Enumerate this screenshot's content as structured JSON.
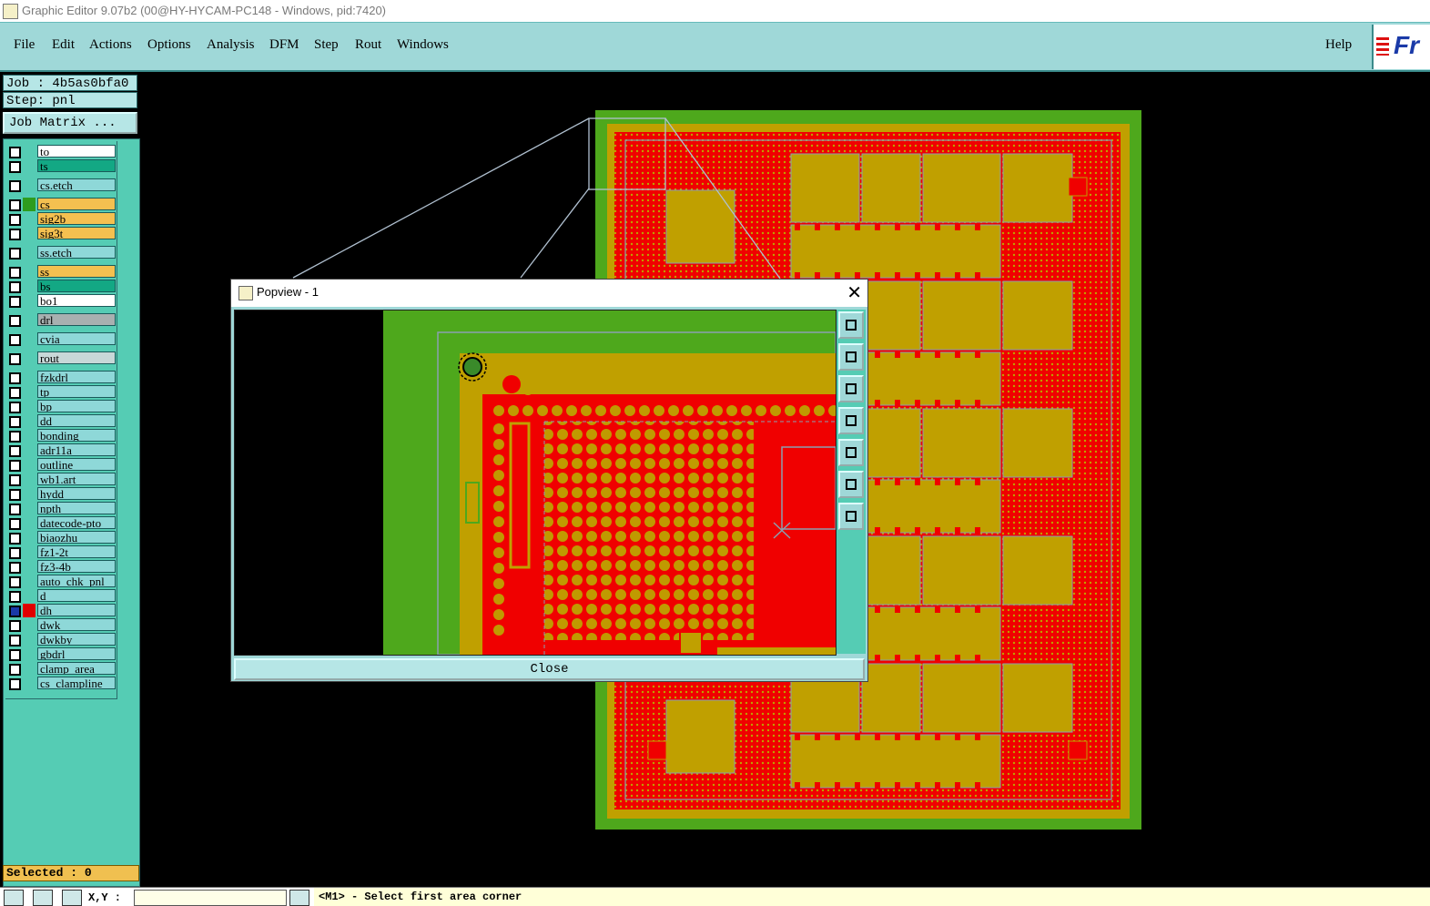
{
  "window": {
    "title": "Graphic Editor 9.07b2 (00@HY-HYCAM-PC148 - Windows, pid:7420)"
  },
  "menubar": {
    "items": [
      "File",
      "Edit",
      "Actions",
      "Options",
      "Analysis",
      "DFM",
      "Step",
      "Rout",
      "Windows"
    ],
    "help": "Help",
    "logo_text": "Fr"
  },
  "job": {
    "label": "Job : 4b5as0bfa0",
    "step": "Step: pnl",
    "matrix_button": "Job Matrix ..."
  },
  "layers": [
    {
      "name": "to",
      "color": "#ffffff",
      "swatch": ""
    },
    {
      "name": "ts",
      "color": "#13a884",
      "swatch": ""
    },
    {
      "name": "cs.etch",
      "color": "#8ed8d8",
      "swatch": ""
    },
    {
      "name": "cs",
      "color": "#f4c050",
      "swatch": "#2e9c1e"
    },
    {
      "name": "sig2b",
      "color": "#f4c050",
      "swatch": ""
    },
    {
      "name": "sig3t",
      "color": "#f4c050",
      "swatch": ""
    },
    {
      "name": "ss.etch",
      "color": "#8ed8d8",
      "swatch": ""
    },
    {
      "name": "ss",
      "color": "#f4c050",
      "swatch": ""
    },
    {
      "name": "bs",
      "color": "#13a884",
      "swatch": ""
    },
    {
      "name": "bo1",
      "color": "#ffffff",
      "swatch": ""
    },
    {
      "name": "drl",
      "color": "#a8b0b0",
      "swatch": ""
    },
    {
      "name": "cvia",
      "color": "#8ed8d8",
      "swatch": ""
    },
    {
      "name": "rout",
      "color": "#c8d8d8",
      "swatch": ""
    },
    {
      "name": "fzkdrl",
      "color": "#8ed8d8",
      "swatch": ""
    },
    {
      "name": "tp",
      "color": "#8ed8d8",
      "swatch": ""
    },
    {
      "name": "bp",
      "color": "#8ed8d8",
      "swatch": ""
    },
    {
      "name": "dd",
      "color": "#8ed8d8",
      "swatch": ""
    },
    {
      "name": "bonding",
      "color": "#8ed8d8",
      "swatch": ""
    },
    {
      "name": "adr11a",
      "color": "#8ed8d8",
      "swatch": ""
    },
    {
      "name": "outline",
      "color": "#8ed8d8",
      "swatch": ""
    },
    {
      "name": "wb1.art",
      "color": "#8ed8d8",
      "swatch": ""
    },
    {
      "name": "hydd",
      "color": "#8ed8d8",
      "swatch": ""
    },
    {
      "name": "npth",
      "color": "#8ed8d8",
      "swatch": ""
    },
    {
      "name": "datecode-pto",
      "color": "#8ed8d8",
      "swatch": ""
    },
    {
      "name": "biaozhu",
      "color": "#8ed8d8",
      "swatch": ""
    },
    {
      "name": "fz1-2t",
      "color": "#8ed8d8",
      "swatch": ""
    },
    {
      "name": "fz3-4b",
      "color": "#8ed8d8",
      "swatch": ""
    },
    {
      "name": "auto_chk_pnl",
      "color": "#8ed8d8",
      "swatch": ""
    },
    {
      "name": "d",
      "color": "#8ed8d8",
      "swatch": ""
    },
    {
      "name": "dh",
      "color": "#8ed8d8",
      "swatch": "#e00000",
      "active": true
    },
    {
      "name": "dwk",
      "color": "#8ed8d8",
      "swatch": ""
    },
    {
      "name": "dwkby",
      "color": "#8ed8d8",
      "swatch": ""
    },
    {
      "name": "gbdrl",
      "color": "#8ed8d8",
      "swatch": ""
    },
    {
      "name": "clamp_area",
      "color": "#8ed8d8",
      "swatch": ""
    },
    {
      "name": "cs_clampline",
      "color": "#8ed8d8",
      "swatch": ""
    }
  ],
  "selected": "Selected : 0",
  "statusbar": {
    "xy_label": "X,Y :",
    "xy_value": "",
    "prompt": "<M1> - Select first area corner"
  },
  "popview": {
    "title": "Popview - 1",
    "close_label": "Close",
    "tools": [
      "zoom-fit-icon",
      "pan-up-icon",
      "pan-down-icon",
      "pan-left-icon",
      "pan-right-icon",
      "zoom-out-icon",
      "zoom-in-icon"
    ]
  },
  "colors": {
    "board_green": "#4ea81c",
    "copper_red": "#f00000",
    "gold": "#c0a000",
    "panel_teal": "#9fd8d8",
    "grid_gray": "#8aa0b0"
  }
}
